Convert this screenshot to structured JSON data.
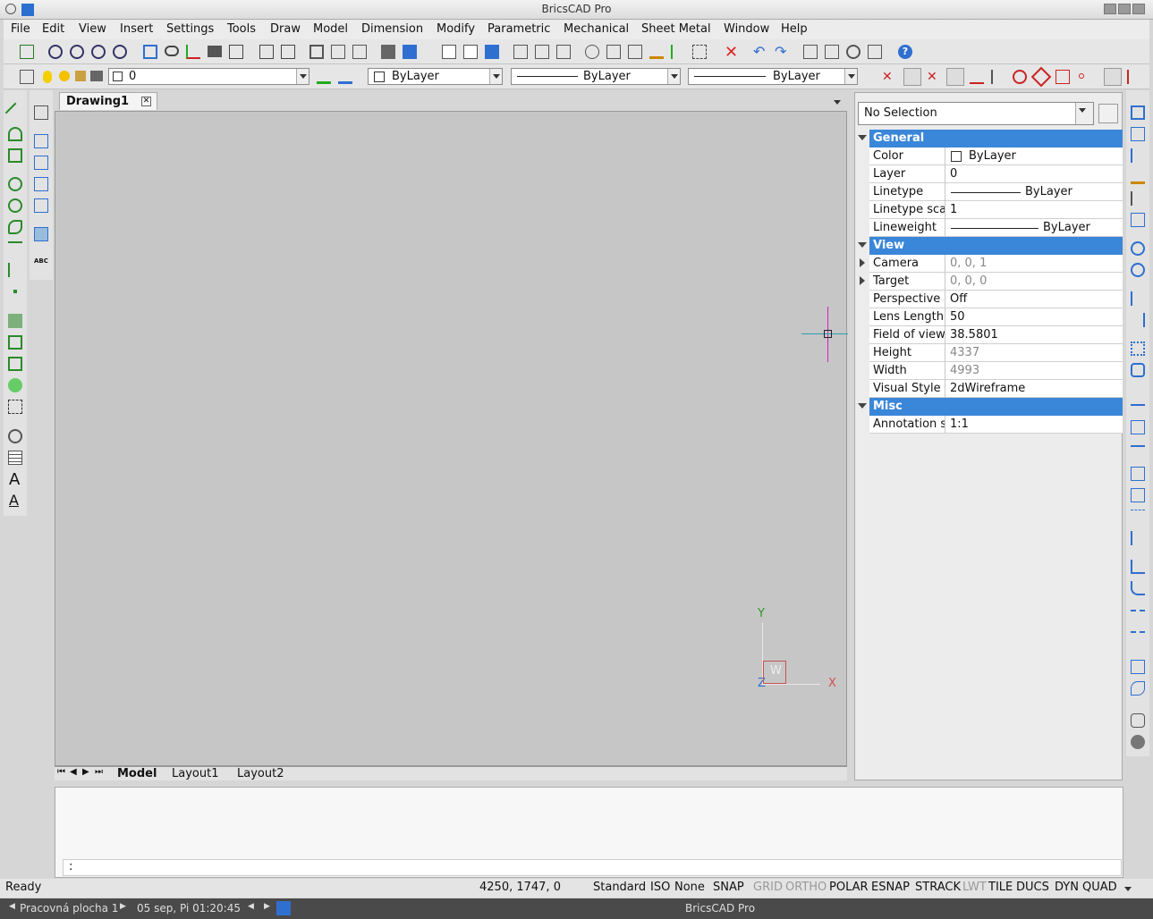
{
  "window": {
    "title": "BricsCAD Pro"
  },
  "menu": [
    "File",
    "Edit",
    "View",
    "Insert",
    "Settings",
    "Tools",
    "Draw",
    "Model",
    "Dimension",
    "Modify",
    "Parametric",
    "Mechanical",
    "Sheet Metal",
    "Window",
    "Help"
  ],
  "layer_toolbar": {
    "layer_value": "0",
    "color_value": "ByLayer",
    "linetype_value": "ByLayer",
    "lineweight_value": "ByLayer"
  },
  "drawing_tab": {
    "label": "Drawing1"
  },
  "ucs": {
    "y": "Y",
    "x": "X",
    "z": "Z",
    "w": "W"
  },
  "layout_tabs": [
    "Model",
    "Layout1",
    "Layout2"
  ],
  "properties": {
    "selection": "No Selection",
    "categories": {
      "general": "General",
      "view": "View",
      "misc": "Misc"
    },
    "general_rows": [
      {
        "name": "Color",
        "value": "ByLayer"
      },
      {
        "name": "Layer",
        "value": "0"
      },
      {
        "name": "Linetype",
        "value": "ByLayer"
      },
      {
        "name": "Linetype sca",
        "value": "1"
      },
      {
        "name": "Lineweight",
        "value": "ByLayer"
      }
    ],
    "view_rows": [
      {
        "name": "Camera",
        "value": "0, 0, 1"
      },
      {
        "name": "Target",
        "value": "0, 0, 0"
      },
      {
        "name": "Perspective",
        "value": "Off"
      },
      {
        "name": "Lens Length",
        "value": "50"
      },
      {
        "name": "Field of view",
        "value": "38.5801"
      },
      {
        "name": "Height",
        "value": "4337"
      },
      {
        "name": "Width",
        "value": "4993"
      },
      {
        "name": "Visual Style",
        "value": "2dWireframe"
      }
    ],
    "misc_rows": [
      {
        "name": "Annotation s",
        "value": "1:1"
      }
    ]
  },
  "command": {
    "prompt": ":"
  },
  "status": {
    "ready": "Ready",
    "coords": "4250, 1747, 0",
    "items": [
      "Standard",
      "ISO",
      "None",
      "SNAP",
      "GRID",
      "ORTHO",
      "POLAR",
      "ESNAP",
      "STRACK",
      "LWT",
      "TILE",
      "DUCS",
      "DYN",
      "QUAD"
    ]
  },
  "taskbar": {
    "workspace": "Pracovná plocha 1",
    "datetime": "05 sep, Pi 01:20:45",
    "app": "BricsCAD Pro"
  }
}
